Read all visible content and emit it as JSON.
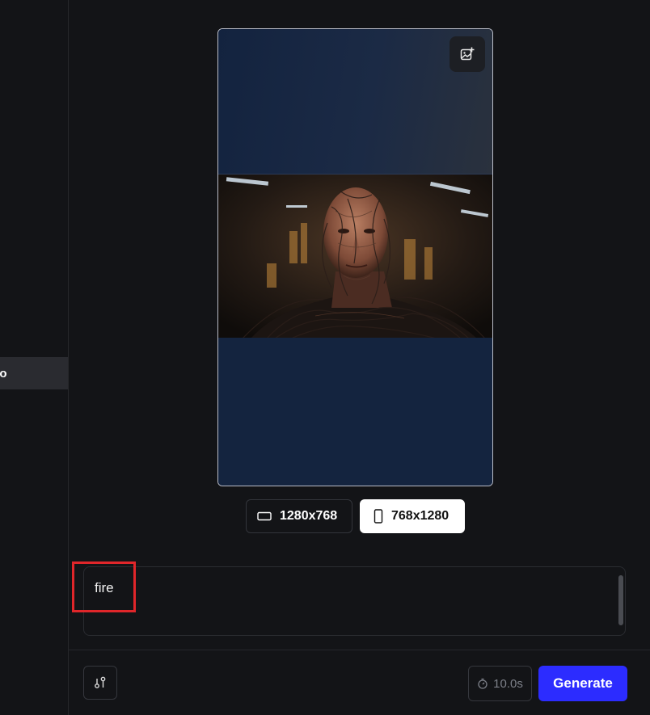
{
  "sidebar": {
    "selected_item_label": "eo"
  },
  "preview": {
    "image_alt": "Close-up portrait of a humanoid figure with skin and body made of tangled wires in a dim industrial hall"
  },
  "aspect_ratios": [
    {
      "label": "1280x768",
      "icon": "landscape-rect-icon",
      "selected": false
    },
    {
      "label": "768x1280",
      "icon": "portrait-rect-icon",
      "selected": true
    }
  ],
  "prompt": {
    "value": "fire"
  },
  "footer": {
    "duration_label": "10.0s",
    "generate_label": "Generate"
  },
  "colors": {
    "accent": "#2c2cff",
    "highlight": "#e0262a",
    "background": "#131417"
  }
}
